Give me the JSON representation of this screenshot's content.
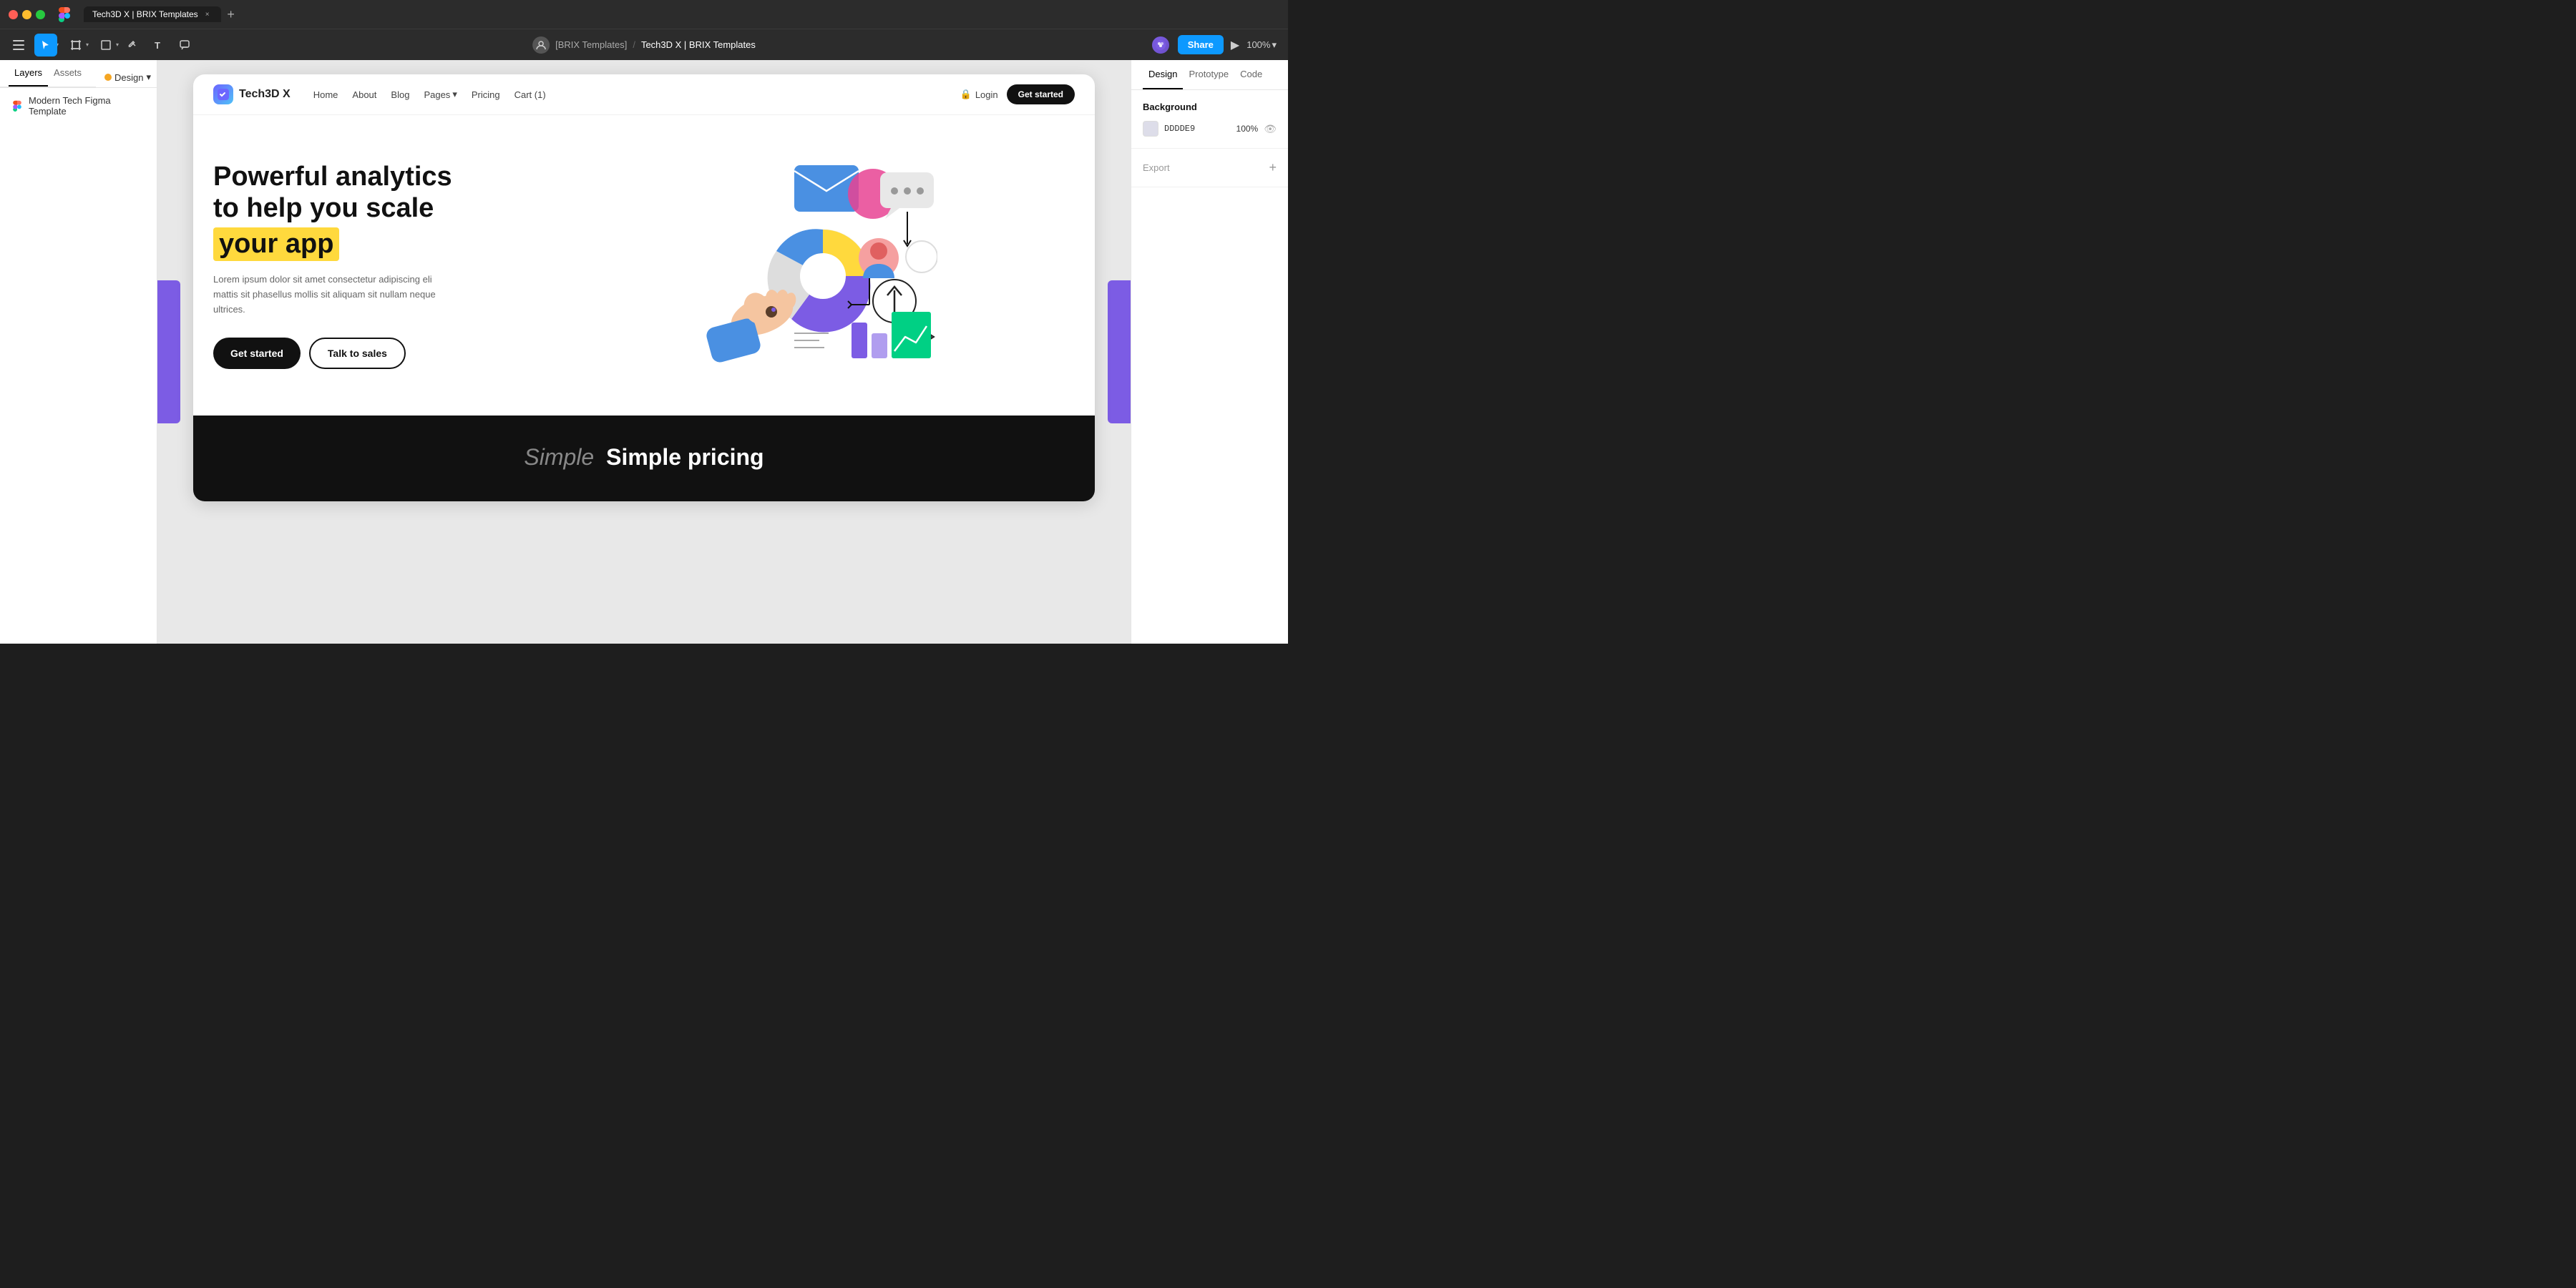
{
  "titleBar": {
    "tabTitle": "Tech3D X | BRIX Templates",
    "tabClose": "×",
    "tabAdd": "+"
  },
  "toolbar": {
    "breadcrumb": {
      "team": "[BRIX Templates]",
      "separator": "/",
      "project": "Tech3D X | BRIX Templates"
    },
    "shareLabel": "Share",
    "zoomLevel": "100%",
    "zoomChevron": "▾"
  },
  "leftSidebar": {
    "tabLayers": "Layers",
    "tabAssets": "Assets",
    "designSelector": "Design",
    "layerItem": {
      "icon": "figma-icon",
      "label": "Modern Tech Figma Template"
    }
  },
  "canvas": {
    "navbar": {
      "logoText": "Tech3D X",
      "navLinks": [
        "Home",
        "About",
        "Blog",
        "Pages",
        "Pricing",
        "Cart (1)"
      ],
      "pagesArrow": "▾",
      "loginLabel": "Login",
      "loginIcon": "🔒",
      "ctaLabel": "Get started"
    },
    "hero": {
      "titleLine1": "Powerful analytics",
      "titleLine2": "to help you scale",
      "titleHighlight": "your app",
      "subtitle": "Lorem ipsum dolor sit amet consectetur adipiscing eli mattis sit phasellus mollis sit aliquam sit nullam neque ultrices.",
      "btnPrimary": "Get started",
      "btnSecondary": "Talk to sales"
    },
    "darkSection": {
      "title": "Simple pricing"
    }
  },
  "rightPanel": {
    "tabDesign": "Design",
    "tabPrototype": "Prototype",
    "tabCode": "Code",
    "backgroundSection": {
      "title": "Background",
      "colorValue": "DDDDE9",
      "opacity": "100%"
    },
    "exportSection": {
      "label": "Export",
      "addIcon": "+"
    }
  },
  "colors": {
    "canvasBg": "#e8e8e8",
    "artboardBg": "#ffffff",
    "heroHighlight": "#ffd93d",
    "darkSection": "#111111",
    "purple": "#7c5ce4",
    "backgroundSwatch": "#DDDDE9",
    "navbarCtaBg": "#111111",
    "primaryBtnBg": "#111111"
  }
}
